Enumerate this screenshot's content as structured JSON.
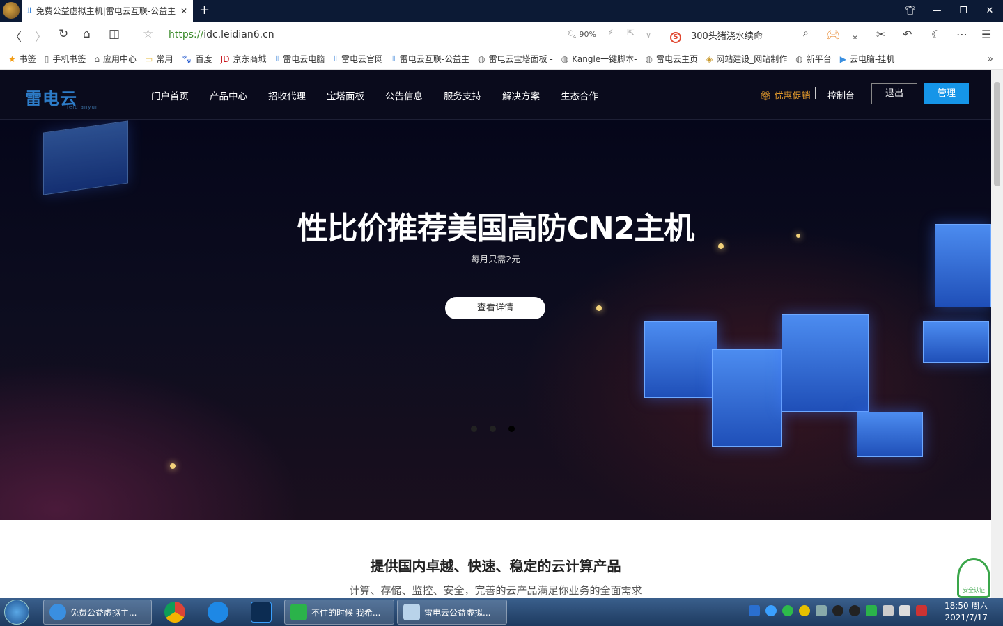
{
  "browser": {
    "tab_title": "免费公益虚拟主机|雷电云互联-公益主",
    "url_scheme": "https://",
    "url_host": "idc.leidian6.cn",
    "zoom": "90%",
    "search_text": "300头猪浇水续命",
    "bookmarks": [
      {
        "label": "书签",
        "icon": "star-icon"
      },
      {
        "label": "手机书签",
        "icon": "phone-icon"
      },
      {
        "label": "应用中心",
        "icon": "app-icon"
      },
      {
        "label": "常用",
        "icon": "folder-icon"
      },
      {
        "label": "百度",
        "icon": "baidu-icon"
      },
      {
        "label": "京东商城",
        "icon": "jd-icon"
      },
      {
        "label": "雷电云电脑",
        "icon": "leidian-icon"
      },
      {
        "label": "雷电云官网",
        "icon": "leidian-icon"
      },
      {
        "label": "雷电云互联-公益主",
        "icon": "leidian-icon"
      },
      {
        "label": "雷电云宝塔面板 -",
        "icon": "globe-icon"
      },
      {
        "label": "Kangle一键脚本-",
        "icon": "globe-icon"
      },
      {
        "label": "雷电云主页",
        "icon": "globe-icon"
      },
      {
        "label": "网站建设_网站制作",
        "icon": "site-icon"
      },
      {
        "label": "新平台",
        "icon": "globe-icon"
      },
      {
        "label": "云电脑-挂机",
        "icon": "d-icon"
      }
    ]
  },
  "site": {
    "logo": "雷电云",
    "logo_sub": "leidianyun",
    "menu": [
      "门户首页",
      "产品中心",
      "招收代理",
      "宝塔面板",
      "公告信息",
      "服务支持",
      "解决方案",
      "生态合作"
    ],
    "promo": "优惠促销",
    "console": "控制台",
    "logout": "退出",
    "manage": "管理",
    "hero_title": "性比价推荐美国高防CN2主机",
    "hero_subtitle": "每月只需2元",
    "hero_button": "查看详情",
    "carousel_active": 3,
    "carousel_count": 3,
    "section_title": "提供国内卓越、快速、稳定的云计算产品",
    "section_subtitle": "计算、存储、监控、安全，完善的云产品满足你业务的全面需求",
    "badge": "安全认证",
    "accent": "#1595e8"
  },
  "taskbar": {
    "items": [
      "免费公益虚拟主...",
      "不住的时候 我希...",
      "雷电云公益虚拟..."
    ],
    "time": "18:50 周六",
    "date": "2021/7/17"
  }
}
